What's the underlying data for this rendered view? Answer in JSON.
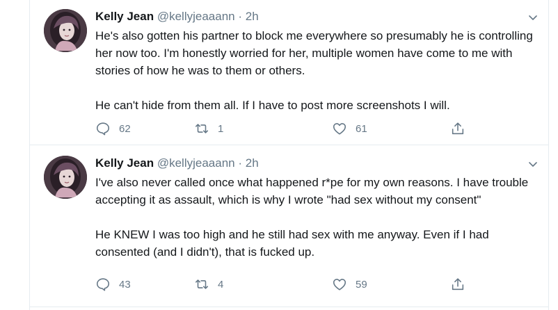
{
  "tweets": [
    {
      "name": "Kelly Jean",
      "handle": "@kellyjeaaann",
      "separator": "·",
      "time": "2h",
      "paragraphs": [
        "He's also gotten his partner to block me everywhere so presumably he is controlling her now too. I'm honestly worried for her, multiple women have come to me with stories of how he was to them or others.",
        "He can't hide from them all. If I have to post more screenshots I will."
      ],
      "replies": "62",
      "retweets": "1",
      "likes": "61"
    },
    {
      "name": "Kelly Jean",
      "handle": "@kellyjeaaann",
      "separator": "·",
      "time": "2h",
      "paragraphs": [
        "I've also never called once what happened r*pe for my own reasons. I have trouble accepting it as assault, which is why I wrote \"had sex without my consent\"",
        "He KNEW I was too high and he still had sex with me anyway. Even if I had consented (and I didn't), that is fucked up."
      ],
      "replies": "43",
      "retweets": "4",
      "likes": "59"
    }
  ],
  "icons": {
    "reply": "reply-icon",
    "retweet": "retweet-icon",
    "like": "heart-icon",
    "share": "share-icon",
    "caret": "chevron-down-icon"
  },
  "colors": {
    "text": "#14171a",
    "secondary": "#657786",
    "divider": "#e6ecf0"
  }
}
